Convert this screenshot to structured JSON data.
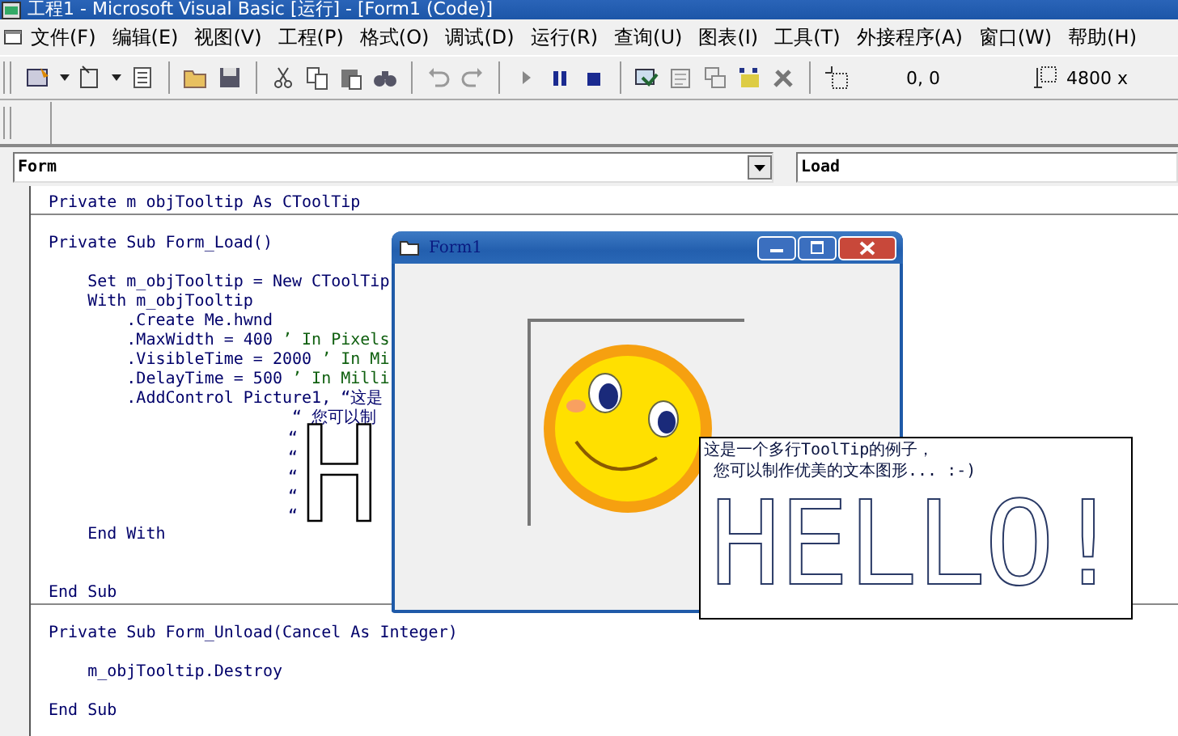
{
  "window": {
    "title": "工程1 - Microsoft Visual Basic [运行] - [Form1 (Code)]"
  },
  "menu": [
    "文件(F)",
    "编辑(E)",
    "视图(V)",
    "工程(P)",
    "格式(O)",
    "调试(D)",
    "运行(R)",
    "查询(U)",
    "图表(I)",
    "工具(T)",
    "外接程序(A)",
    "窗口(W)",
    "帮助(H)"
  ],
  "toolbar": {
    "position": "0, 0",
    "size": "4800 x"
  },
  "object_combo": {
    "value": "Form"
  },
  "procedure_combo": {
    "value": "Load"
  },
  "code": [
    {
      "kind": "code",
      "text": "Private m objTooltip As CToolTip"
    },
    {
      "kind": "separator"
    },
    {
      "kind": "blank"
    },
    {
      "kind": "code",
      "text": "Private Sub Form_Load()"
    },
    {
      "kind": "blank"
    },
    {
      "kind": "code",
      "text": "    Set m_objTooltip = New CToolTip"
    },
    {
      "kind": "code",
      "text": "    With m_objTooltip"
    },
    {
      "kind": "code",
      "text": "        .Create Me.hwnd"
    },
    {
      "kind": "code",
      "text": "        .MaxWidth = 400 ",
      "comment": "’ In Pixels"
    },
    {
      "kind": "code",
      "text": "        .VisibleTime = 2000 ",
      "comment": "’ In Mi"
    },
    {
      "kind": "code",
      "text": "        .DelayTime = 500 ",
      "comment": "’ In Milli"
    },
    {
      "kind": "code",
      "text": "        .AddControl Picture1, “这是"
    },
    {
      "kind": "code",
      "text": "                         “ 您可以制"
    },
    {
      "kind": "art",
      "quotes": [
        "“",
        "“",
        "“",
        "“",
        "“"
      ],
      "art": "H"
    },
    {
      "kind": "code",
      "text": "    End With"
    },
    {
      "kind": "blank"
    },
    {
      "kind": "blank"
    },
    {
      "kind": "code",
      "text": "End Sub"
    },
    {
      "kind": "separator"
    },
    {
      "kind": "blank"
    },
    {
      "kind": "code",
      "text": "Private Sub Form_Unload(Cancel As Integer)"
    },
    {
      "kind": "blank"
    },
    {
      "kind": "code",
      "text": "    m_objTooltip.Destroy"
    },
    {
      "kind": "blank"
    },
    {
      "kind": "code",
      "text": "End Sub"
    }
  ],
  "form_window": {
    "title": "Form1"
  },
  "tooltip": {
    "lines": [
      "这是一个多行ToolTip的例子，",
      " 您可以制作优美的文本图形... :-)"
    ],
    "art": "HELLO!"
  }
}
